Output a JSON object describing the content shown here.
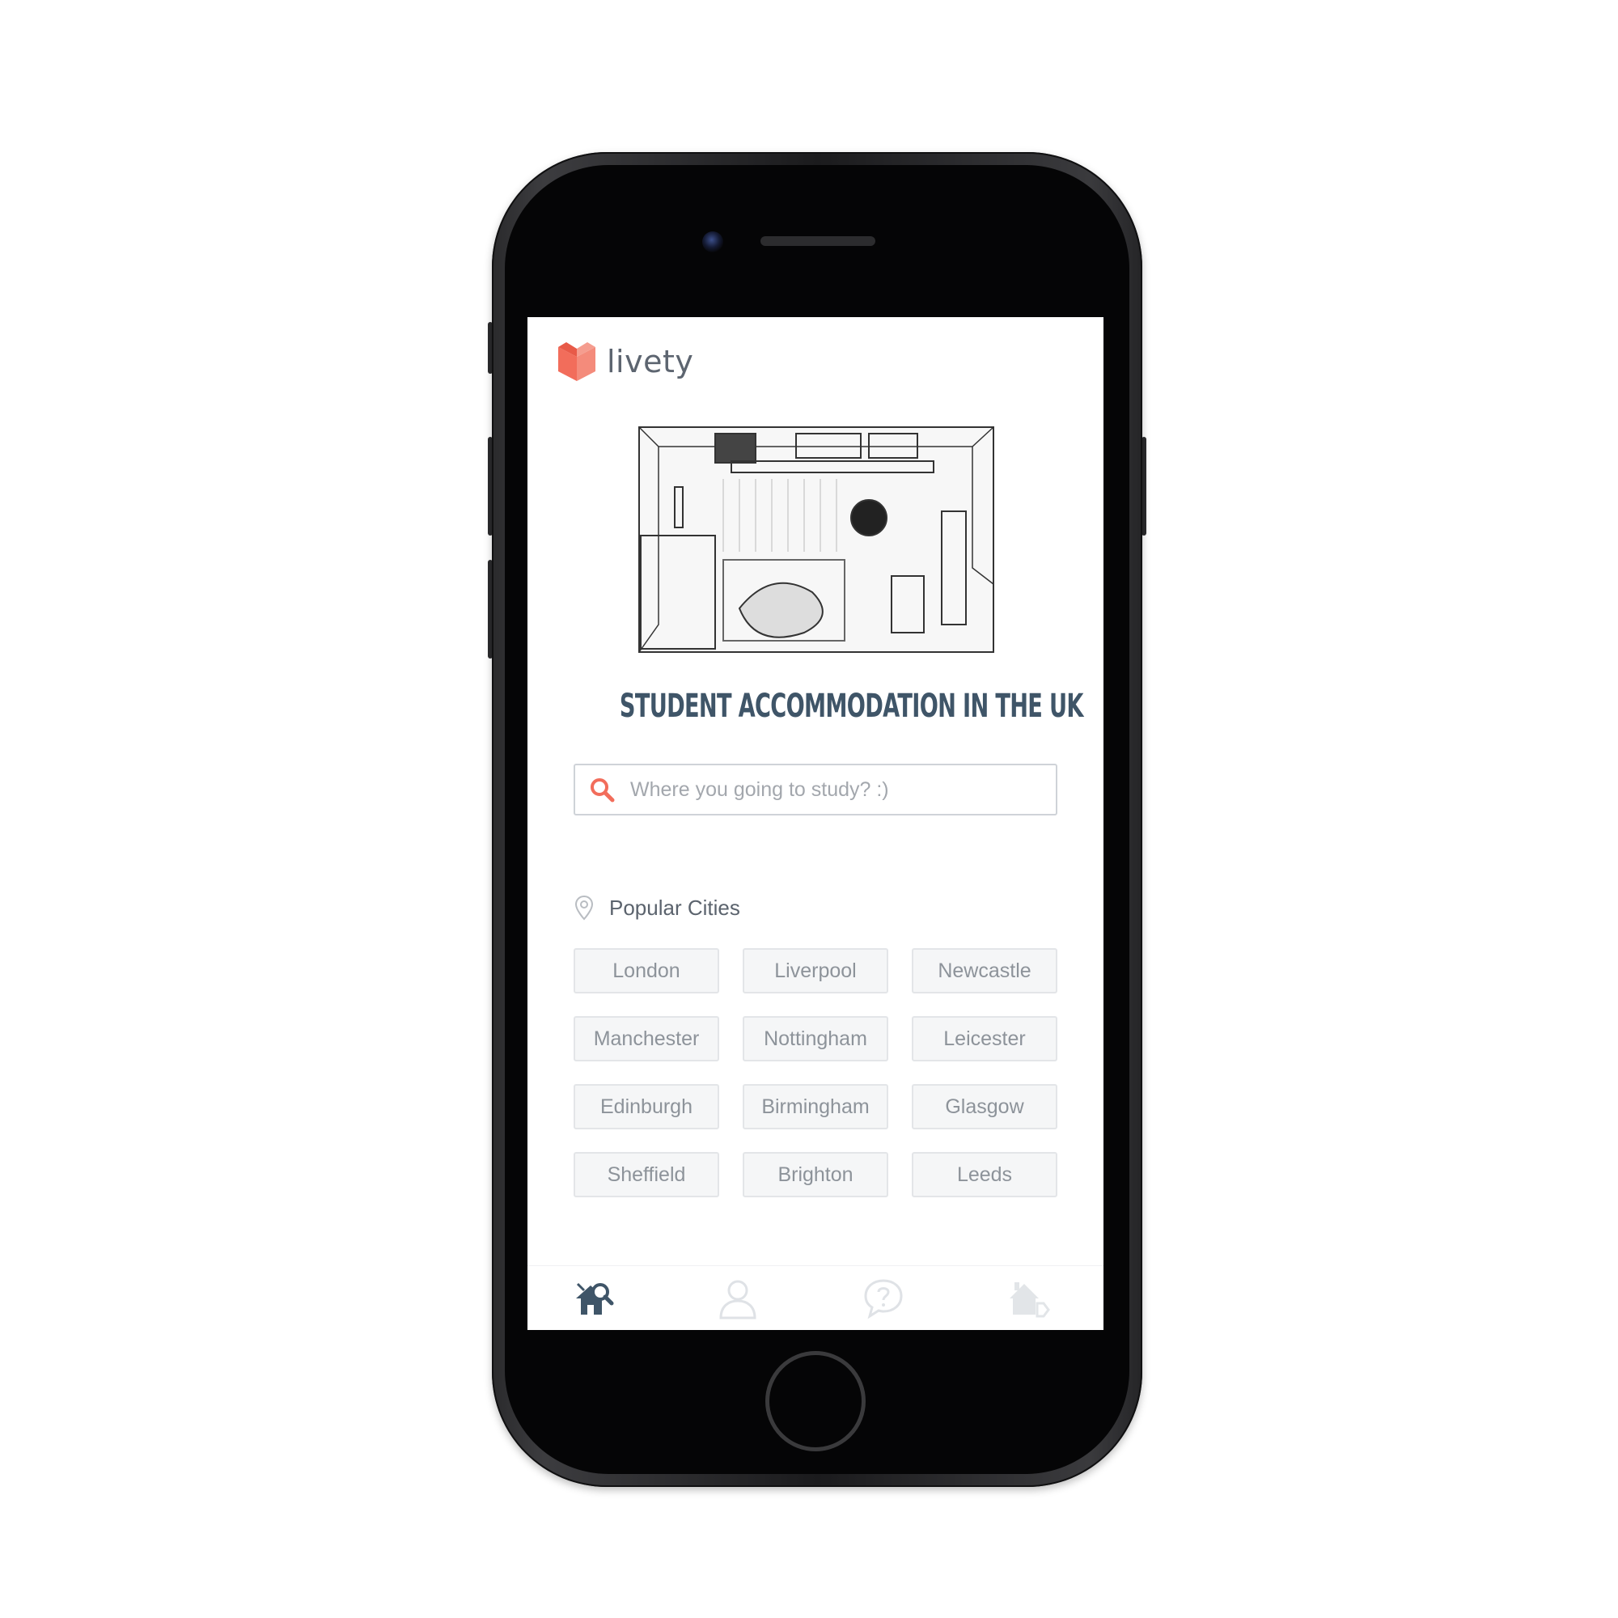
{
  "app": {
    "brand_name": "livety",
    "brand_color": "#f26d5b",
    "tagline": "STUDENT ACCOMMODATION IN THE UK"
  },
  "hero": {
    "icon": "room-sketch-illustration"
  },
  "search": {
    "placeholder": "Where you going to study? :)",
    "value": "",
    "icon": "search-icon",
    "icon_color": "#f26d5b"
  },
  "popular": {
    "title": "Popular Cities",
    "icon": "map-pin-icon",
    "cities": [
      "London",
      "Liverpool",
      "Newcastle",
      "Manchester",
      "Nottingham",
      "Leicester",
      "Edinburgh",
      "Birmingham",
      "Glasgow",
      "Sheffield",
      "Brighton",
      "Leeds"
    ]
  },
  "tabbar": {
    "active_color": "#3f5568",
    "inactive_color": "#dfe2e6",
    "tabs": [
      {
        "icon": "home-search-icon",
        "active": true
      },
      {
        "icon": "user-icon",
        "active": false
      },
      {
        "icon": "chat-question-icon",
        "active": false
      },
      {
        "icon": "home-tag-icon",
        "active": false
      }
    ]
  }
}
